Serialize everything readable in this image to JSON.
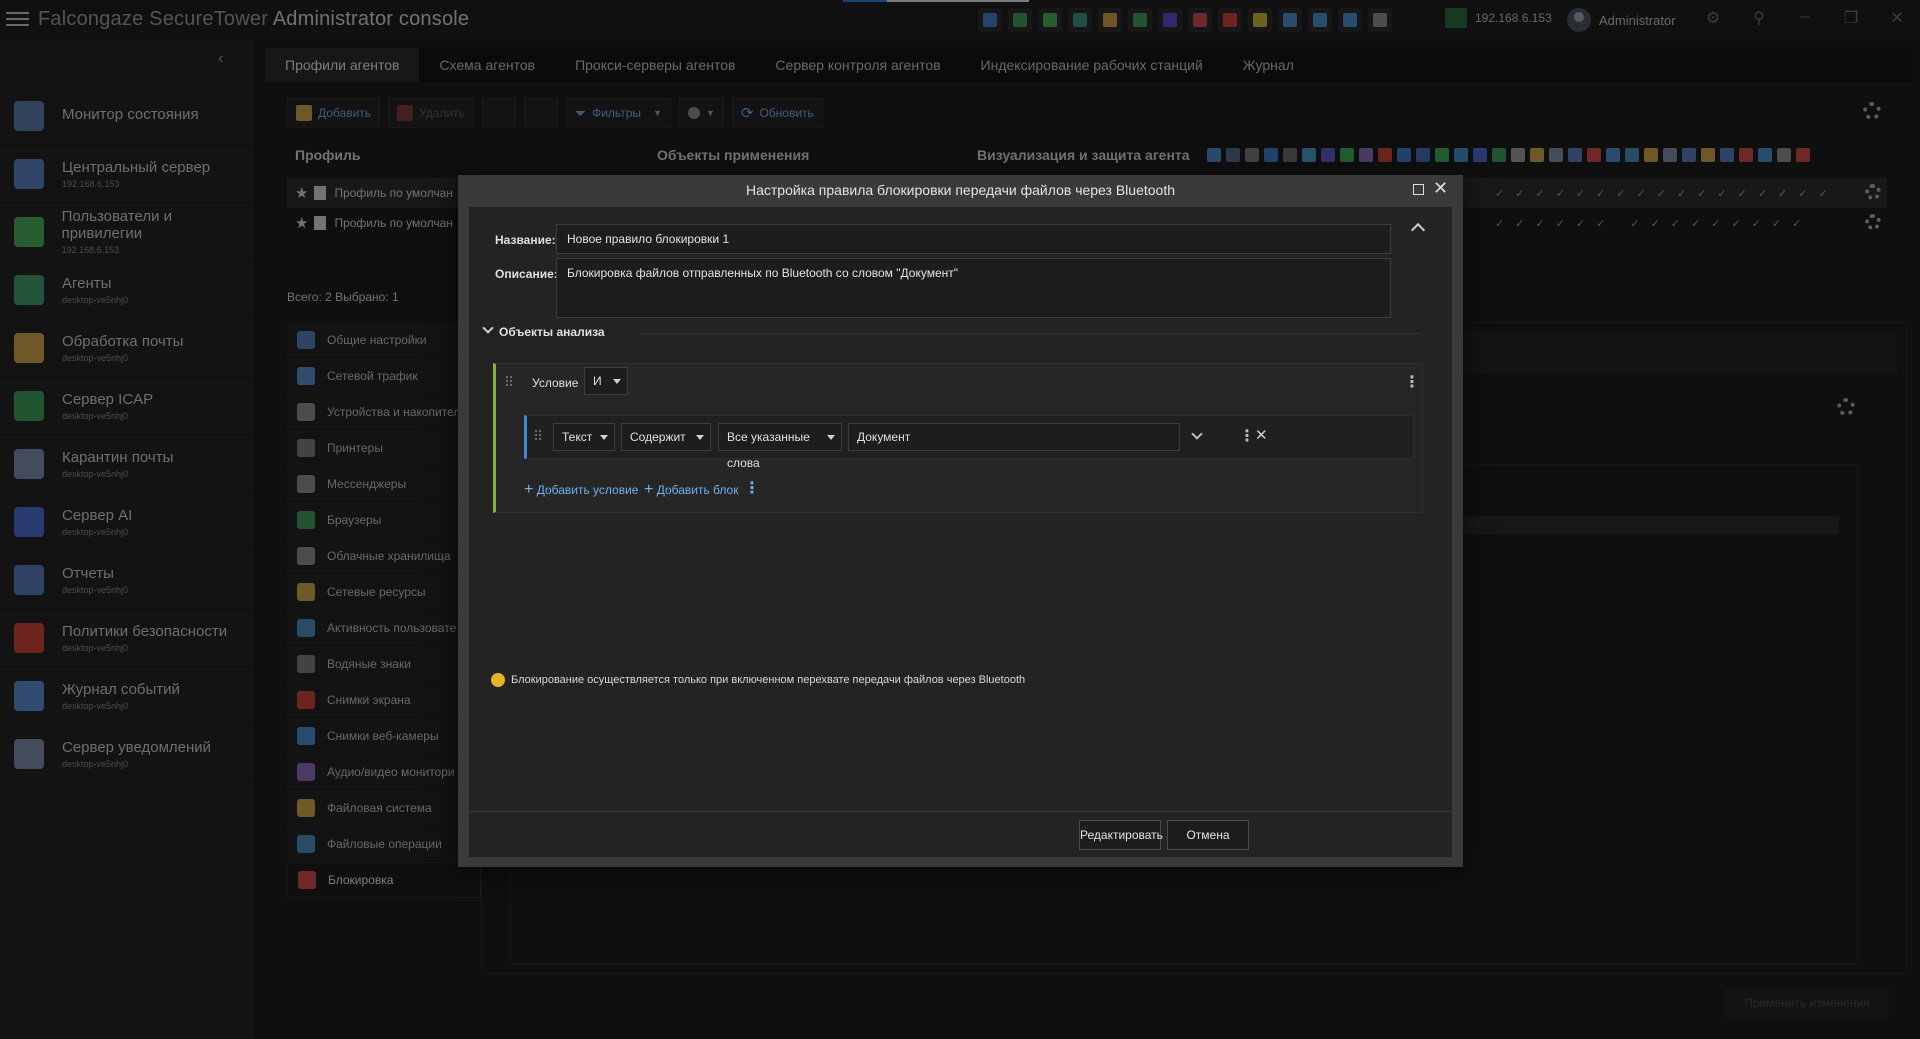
{
  "app": {
    "title_brand": "Falcongaze SecureTower",
    "title_console": "Administrator console",
    "ip": "192.168.6.153",
    "user": "Administrator"
  },
  "titlebar_icons": [
    {
      "name": "shield-icon",
      "color": "#4a79c8"
    },
    {
      "name": "server-icon",
      "color": "#3b9a5a"
    },
    {
      "name": "users-icon",
      "color": "#4aa85a"
    },
    {
      "name": "agents-icon",
      "color": "#3f8f7a"
    },
    {
      "name": "mail-icon",
      "color": "#c89b3c"
    },
    {
      "name": "icap-icon",
      "color": "#3f9a5a"
    },
    {
      "name": "ai-icon",
      "color": "#5a4fc8"
    },
    {
      "name": "report-icon",
      "color": "#c84a4a"
    },
    {
      "name": "policy-icon",
      "color": "#c8443a"
    },
    {
      "name": "books-icon",
      "color": "#c8b03a"
    },
    {
      "name": "log-icon",
      "color": "#4a8ac8"
    },
    {
      "name": "monitor-icon",
      "color": "#4a8ac8"
    },
    {
      "name": "network-icon",
      "color": "#4a8ac8"
    },
    {
      "name": "printer-icon",
      "color": "#8a8a8a"
    }
  ],
  "sidebar": {
    "items": [
      {
        "name": "nav-item-status-monitor",
        "icon": "monitor-icon",
        "color": "#5b7aa8",
        "label": "Монитор состояния",
        "sub": ""
      },
      {
        "name": "nav-item-central-server",
        "icon": "shield-icon",
        "color": "#5a7ec0",
        "label": "Центральный сервер",
        "sub": "192.168.6.153"
      },
      {
        "name": "nav-item-users",
        "icon": "users-icon",
        "color": "#4aa85a",
        "label": "Пользователи и привилегии",
        "sub": "192.168.6.153"
      },
      {
        "name": "nav-item-agents",
        "icon": "agents-icon",
        "color": "#3f9a6a",
        "label": "Агенты",
        "sub": "desktop-ve5nhj0"
      },
      {
        "name": "nav-item-mail-processing",
        "icon": "mail-icon",
        "color": "#c8a04a",
        "label": "Обработка почты",
        "sub": "desktop-ve5nhj0"
      },
      {
        "name": "nav-item-icap",
        "icon": "icap-icon",
        "color": "#3f9a5a",
        "label": "Сервер ICAP",
        "sub": "desktop-ve5nhj0"
      },
      {
        "name": "nav-item-mail-quarantine",
        "icon": "quarantine-icon",
        "color": "#7a8aa8",
        "label": "Карантин почты",
        "sub": "desktop-ve5nhj0"
      },
      {
        "name": "nav-item-ai-server",
        "icon": "ai-icon",
        "color": "#4a6ac8",
        "label": "Сервер AI",
        "sub": "desktop-ve5nhj0"
      },
      {
        "name": "nav-item-reports",
        "icon": "report-icon",
        "color": "#5a7ab8",
        "label": "Отчеты",
        "sub": "desktop-ve5nhj0"
      },
      {
        "name": "nav-item-security-policies",
        "icon": "policy-icon",
        "color": "#c8443a",
        "label": "Политики безопасности",
        "sub": "desktop-ve5nhj0"
      },
      {
        "name": "nav-item-event-log",
        "icon": "log-icon",
        "color": "#5a8ac8",
        "label": "Журнал событий",
        "sub": "desktop-ve5nhj0"
      },
      {
        "name": "nav-item-notification-server",
        "icon": "notification-icon",
        "color": "#7a8aa8",
        "label": "Сервер уведомлений",
        "sub": "desktop-ve5nhj0"
      }
    ]
  },
  "tabs": [
    "Профили агентов",
    "Схема агентов",
    "Прокси-серверы агентов",
    "Сервер контроля агентов",
    "Индексирование рабочих станций",
    "Журнал"
  ],
  "toolbar": {
    "add": "Добавить",
    "delete": "Удалить",
    "filters": "Фильтры",
    "refresh": "Обновить"
  },
  "grid": {
    "col_profile": "Профиль",
    "col_objects": "Объекты применения",
    "col_visual": "Визуализация и защита агента",
    "rows": [
      "Профиль по умолчан",
      "Профиль по умолчан"
    ],
    "row1_checks": "✓✓✓✓✓✓✓✓✓✓✓✓✓✓✓✓✓",
    "row2_checks": "✓✓✓✓✓✓  ✓✓✓✓✓✓✓✓✓"
  },
  "counts": "Всего: 2   Выбрано: 1",
  "sublist": [
    {
      "label": "Общие настройки",
      "icon": "settings-icon",
      "color": "#5a7ab8"
    },
    {
      "label": "Сетевой трафик",
      "icon": "traffic-icon",
      "color": "#5a8ac8"
    },
    {
      "label": "Устройства и накопител",
      "icon": "usb-icon",
      "color": "#8a8a8a"
    },
    {
      "label": "Принтеры",
      "icon": "printer-icon",
      "color": "#7a7a7a"
    },
    {
      "label": "Мессенджеры",
      "icon": "messenger-icon",
      "color": "#8a8a8a"
    },
    {
      "label": "Браузеры",
      "icon": "browser-icon",
      "color": "#3f9a5a"
    },
    {
      "label": "Облачные хранилища",
      "icon": "cloud-icon",
      "color": "#8a8a8a"
    },
    {
      "label": "Сетевые ресурсы",
      "icon": "folder-icon",
      "color": "#c8a04a"
    },
    {
      "label": "Активность пользовате",
      "icon": "activity-icon",
      "color": "#4a8ab8"
    },
    {
      "label": "Водяные знаки",
      "icon": "watermark-icon",
      "color": "#7a7a7a"
    },
    {
      "label": "Снимки экрана",
      "icon": "screenshot-icon",
      "color": "#c8443a"
    },
    {
      "label": "Снимки веб-камеры",
      "icon": "webcam-icon",
      "color": "#4a8ac8"
    },
    {
      "label": "Аудио/видео монитори",
      "icon": "av-icon",
      "color": "#8a6ab8"
    },
    {
      "label": "Файловая система",
      "icon": "filesystem-icon",
      "color": "#c8a04a"
    },
    {
      "label": "Файловые операции",
      "icon": "fileops-icon",
      "color": "#4a8ab8"
    },
    {
      "label": "Блокировка",
      "icon": "block-icon",
      "color": "#c84a4a"
    }
  ],
  "apply": "Применить изменения",
  "dialog": {
    "title": "Настройка правила блокировки передачи файлов через Bluetooth",
    "name_label": "Название:",
    "name_value": "Новое правило блокировки 1",
    "desc_label": "Описание:",
    "desc_value": "Блокировка файлов отправленных по Bluetooth со словом \"Документ\"",
    "section": "Объекты анализа",
    "condition_label": "Условие",
    "condition_op": "И",
    "field_type": "Текст",
    "field_match": "Содержит",
    "field_mode": "Все указанные слова",
    "field_value": "Документ",
    "add_condition": "Добавить условие",
    "add_block": "Добавить блок",
    "warning": "Блокирование осуществляется только при включенном перехвате передачи файлов через Bluetooth",
    "edit_btn": "Редактировать",
    "cancel_btn": "Отмена"
  }
}
